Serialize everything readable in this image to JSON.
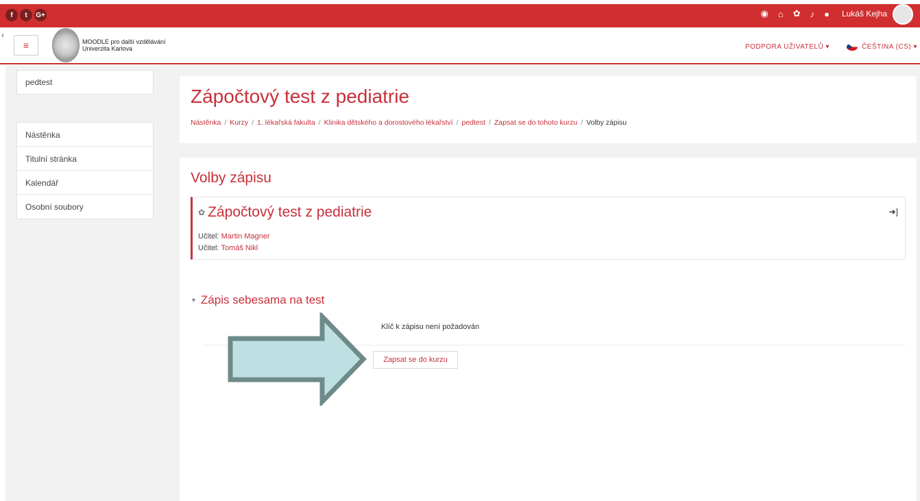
{
  "topbar": {
    "social": [
      "f",
      "t",
      "G+"
    ],
    "icons": [
      "dashboard-icon",
      "home-icon",
      "groups-icon",
      "bell-icon",
      "chat-icon"
    ],
    "username": "Lukáš Kejha"
  },
  "header": {
    "brand_line1": "MOODLE pro další vzdělávání",
    "brand_line2": "Univerzita Karlova",
    "support": "PODPORA UŽIVATELŮ ▾",
    "language": "ČEŠTINA (CS) ▾"
  },
  "sidebar": {
    "course": "pedtest",
    "items": [
      {
        "label": "Nástěnka"
      },
      {
        "label": "Titulní stránka"
      },
      {
        "label": "Kalendář"
      },
      {
        "label": "Osobní soubory"
      }
    ]
  },
  "page": {
    "title": "Zápočtový test z pediatrie",
    "breadcrumb": [
      "Nástěnka",
      "Kurzy",
      "1. lékařská fakulta",
      "Klinika dětského a dorostového lékařství",
      "pedtest",
      "Zapsat se do tohoto kurzu",
      "Volby zápisu"
    ]
  },
  "enrol": {
    "section_title": "Volby zápisu",
    "course_name": "Zápočtový test z pediatrie",
    "teachers": [
      {
        "label": "Učitel:",
        "name": "Martin Magner"
      },
      {
        "label": "Učitel:",
        "name": "Tomáš Nikl"
      }
    ],
    "self_title": "Zápis sebesama na test",
    "key_note": "Klíč k zápisu není požadován",
    "button": "Zapsat se do kurzu"
  },
  "colors": {
    "brand_red": "#d02e2f",
    "link_red": "#c8303a",
    "arrow_fill": "#bfe0e2",
    "arrow_stroke": "#6e8a89"
  }
}
